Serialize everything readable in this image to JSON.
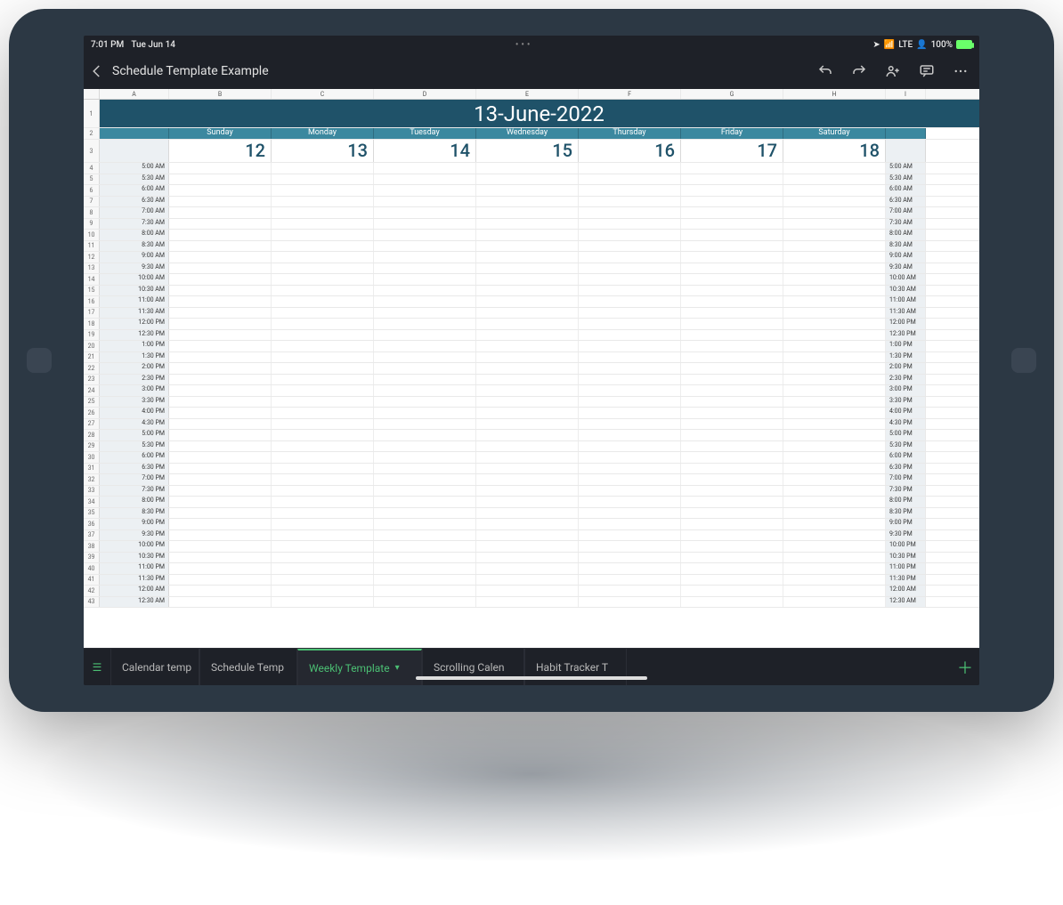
{
  "status": {
    "time": "7:01 PM",
    "date": "Tue Jun 14",
    "network": "LTE",
    "battery": "100%"
  },
  "app": {
    "title": "Schedule Template Example"
  },
  "columns": [
    "A",
    "B",
    "C",
    "D",
    "E",
    "F",
    "G",
    "H",
    "I"
  ],
  "sheet": {
    "title": "13-June-2022",
    "days": [
      "Sunday",
      "Monday",
      "Tuesday",
      "Wednesday",
      "Thursday",
      "Friday",
      "Saturday"
    ],
    "dates": [
      "12",
      "13",
      "14",
      "15",
      "16",
      "17",
      "18"
    ],
    "times": [
      "5:00 AM",
      "5:30 AM",
      "6:00 AM",
      "6:30 AM",
      "7:00 AM",
      "7:30 AM",
      "8:00 AM",
      "8:30 AM",
      "9:00 AM",
      "9:30 AM",
      "10:00 AM",
      "10:30 AM",
      "11:00 AM",
      "11:30 AM",
      "12:00 PM",
      "12:30 PM",
      "1:00 PM",
      "1:30 PM",
      "2:00 PM",
      "2:30 PM",
      "3:00 PM",
      "3:30 PM",
      "4:00 PM",
      "4:30 PM",
      "5:00 PM",
      "5:30 PM",
      "6:00 PM",
      "6:30 PM",
      "7:00 PM",
      "7:30 PM",
      "8:00 PM",
      "8:30 PM",
      "9:00 PM",
      "9:30 PM",
      "10:00 PM",
      "10:30 PM",
      "11:00 PM",
      "11:30 PM",
      "12:00 AM",
      "12:30 AM"
    ]
  },
  "tabs": {
    "list": [
      {
        "label": "Calendar temp"
      },
      {
        "label": "Schedule Temp"
      },
      {
        "label": "Weekly Template"
      },
      {
        "label": "Scrolling Calen"
      },
      {
        "label": "Habit Tracker T"
      }
    ],
    "active_index": 2
  }
}
